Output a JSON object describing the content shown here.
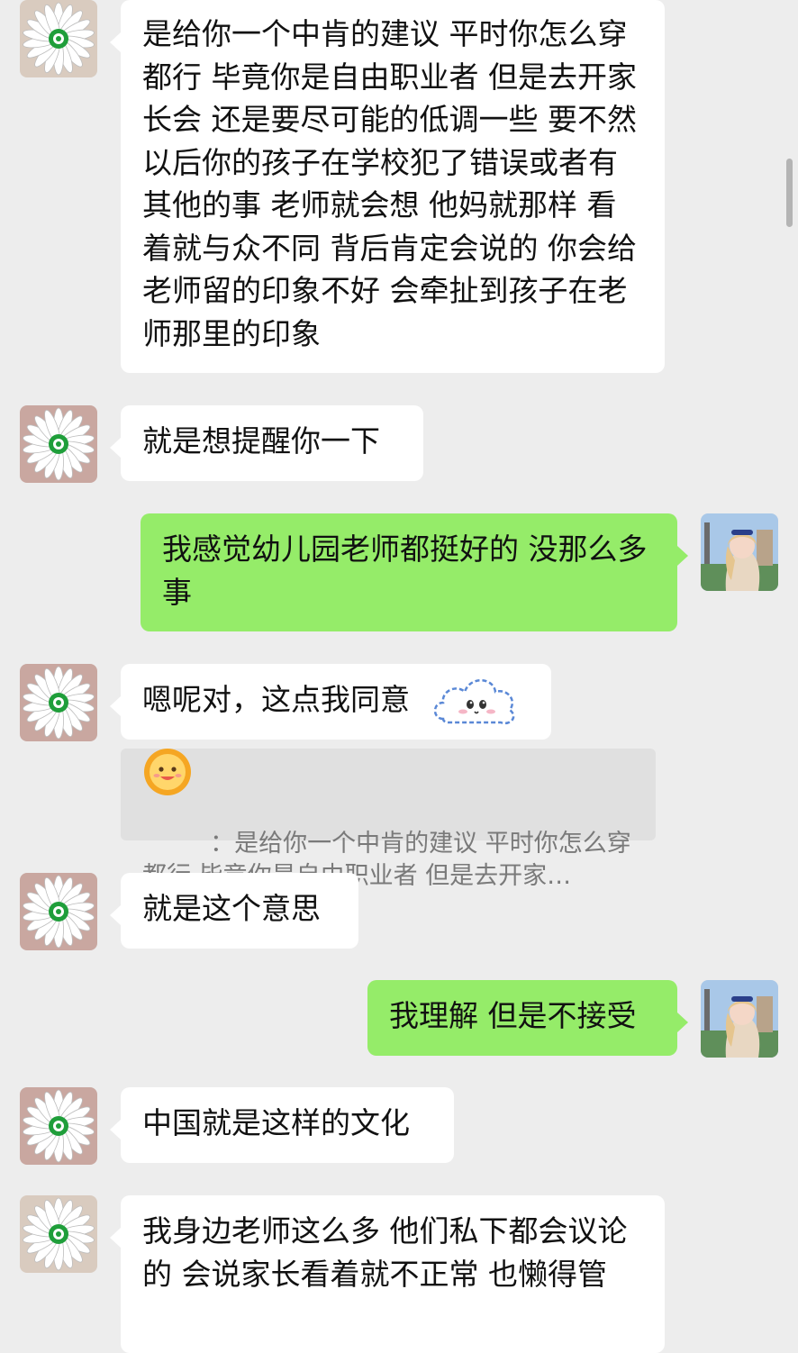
{
  "contact": {
    "avatar_icon": "daisy-flower-icon"
  },
  "me": {
    "avatar_icon": "user-photo-icon"
  },
  "colors": {
    "background": "#ededed",
    "incoming_bubble": "#ffffff",
    "outgoing_bubble": "#95ec69",
    "quote_background": "#e0e0e0",
    "quote_text": "#7a7a7a"
  },
  "messages": [
    {
      "from": "contact",
      "text": "是给你一个中肯的建议 平时你怎么穿都行 毕竟你是自由职业者 但是去开家长会 还是要尽可能的低调一些 要不然以后你的孩子在学校犯了错误或者有其他的事 老师就会想 他妈就那样 看着就与众不同 背后肯定会说的 你会给老师留的印象不好 会牵扯到孩子在老师那里的印象"
    },
    {
      "from": "contact",
      "text": "就是想提醒你一下"
    },
    {
      "from": "me",
      "text": "我感觉幼儿园老师都挺好的 没那么多事"
    },
    {
      "from": "contact",
      "text": "嗯呢对，这点我同意",
      "sticker_icon": "cloud-face-sticker-icon",
      "quote": {
        "sender_icon": "smiley-sun-emoji-icon",
        "separator": "：",
        "text": "是给你一个中肯的建议 平时你怎么穿都行 毕竟你是自由职业者 但是去开家…"
      }
    },
    {
      "from": "contact",
      "text": "就是这个意思"
    },
    {
      "from": "me",
      "text": "我理解 但是不接受"
    },
    {
      "from": "contact",
      "text": "中国就是这样的文化"
    },
    {
      "from": "contact",
      "text": "我身边老师这么多 他们私下都会议论的 会说家长看着就不正常 也懒得管"
    }
  ]
}
